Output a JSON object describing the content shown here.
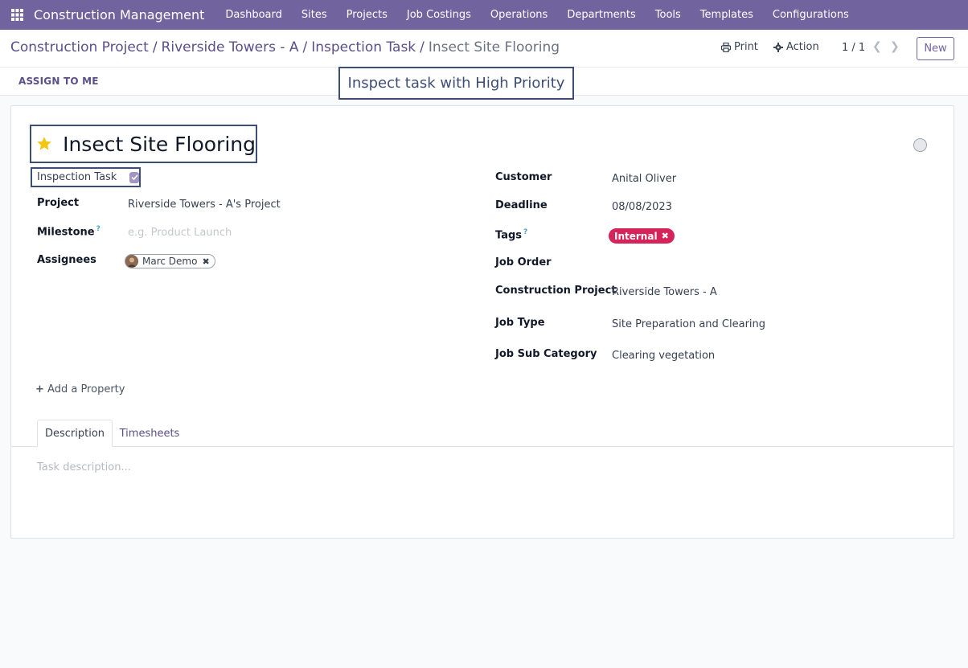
{
  "nav": {
    "app_name": "Construction Management",
    "menu": [
      "Dashboard",
      "Sites",
      "Projects",
      "Job Costings",
      "Operations",
      "Departments",
      "Tools",
      "Templates",
      "Configurations"
    ]
  },
  "breadcrumb": {
    "items": [
      "Construction Project",
      "Riverside Towers - A",
      "Inspection Task"
    ],
    "current": "Insect Site Flooring",
    "separator": "/"
  },
  "controls": {
    "print": "Print",
    "action": "Action",
    "pager": "1 / 1",
    "new": "New"
  },
  "statusbar": {
    "assign_to_me": "ASSIGN TO ME"
  },
  "tooltip": "Inspect task with High Priority",
  "task": {
    "title": "Insect Site Flooring",
    "inspection_label": "Inspection Task",
    "inspection_checked": true
  },
  "fields_left": {
    "project_label": "Project",
    "project_value": "Riverside Towers - A's Project",
    "milestone_label": "Milestone",
    "milestone_placeholder": "e.g. Product Launch",
    "assignees_label": "Assignees",
    "assignee": "Marc Demo"
  },
  "fields_right": {
    "customer_label": "Customer",
    "customer_value": "Anital Oliver",
    "deadline_label": "Deadline",
    "deadline_value": "08/08/2023",
    "tags_label": "Tags",
    "tag": "Internal",
    "job_order_label": "Job Order",
    "construction_project_label": "Construction Project",
    "construction_project_value": "Riverside Towers - A",
    "job_type_label": "Job Type",
    "job_type_value": "Site Preparation and Clearing",
    "job_sub_category_label": "Job Sub Category",
    "job_sub_category_value": "Clearing vegetation"
  },
  "help_marker": "?",
  "add_property": "Add a Property",
  "tabs": {
    "description": "Description",
    "timesheets": "Timesheets"
  },
  "description_placeholder": "Task description...",
  "colors": {
    "nav_bg": "#71639e",
    "tag_bg": "#d5245a",
    "star": "#f3c613",
    "highlight_border": "#3e4d75"
  }
}
